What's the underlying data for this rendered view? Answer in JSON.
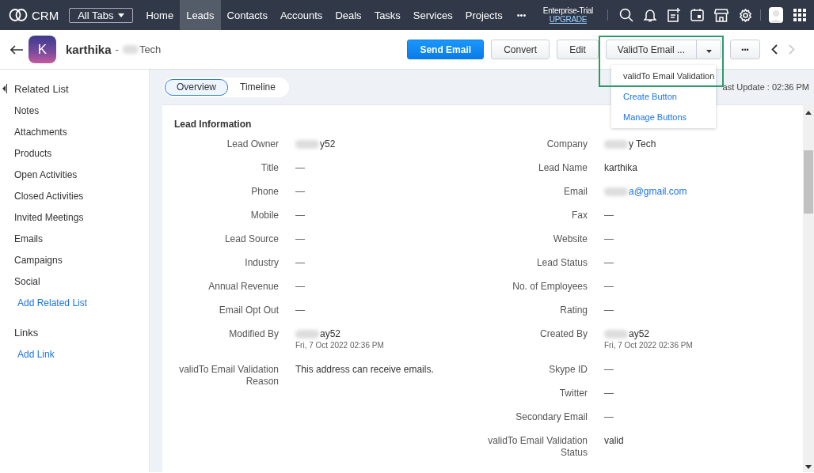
{
  "topbar": {
    "logo_text": "CRM",
    "all_tabs": "All Tabs",
    "nav": [
      {
        "label": "Home",
        "selected": false
      },
      {
        "label": "Leads",
        "selected": true
      },
      {
        "label": "Contacts",
        "selected": false
      },
      {
        "label": "Accounts",
        "selected": false
      },
      {
        "label": "Deals",
        "selected": false
      },
      {
        "label": "Tasks",
        "selected": false
      },
      {
        "label": "Services",
        "selected": false
      },
      {
        "label": "Projects",
        "selected": false
      }
    ],
    "more": "•••",
    "edition": "Enterprise-Trial",
    "upgrade": "UPGRADE"
  },
  "record": {
    "avatar_letter": "K",
    "name": "karthika",
    "separator": "-",
    "company": "Tech",
    "company_blurred": true
  },
  "actions": [
    {
      "label": "Send Email",
      "kind": "primary"
    },
    {
      "label": "Convert",
      "kind": "plain"
    },
    {
      "label": "Edit",
      "kind": "plain"
    },
    {
      "label": "ValidTo Email ...",
      "kind": "split"
    },
    {
      "label": "•••",
      "kind": "more"
    }
  ],
  "nav_arrows": [
    {
      "kind": "prev",
      "disabled": false
    },
    {
      "kind": "next",
      "disabled": true
    }
  ],
  "dropdown": {
    "items": [
      {
        "label": "validTo Email Validation",
        "kind": "action"
      },
      {
        "label": "Create Button",
        "kind": "link"
      },
      {
        "label": "Manage Buttons",
        "kind": "link"
      }
    ]
  },
  "view_tabs": [
    {
      "label": "Overview",
      "selected": true
    },
    {
      "label": "Timeline",
      "selected": false
    }
  ],
  "last_update": "ast Update : 02:36 PM",
  "sidebar": {
    "title": "Related List",
    "items": [
      {
        "label": "Notes",
        "kind": "item"
      },
      {
        "label": "Attachments",
        "kind": "item"
      },
      {
        "label": "Products",
        "kind": "item"
      },
      {
        "label": "Open Activities",
        "kind": "item"
      },
      {
        "label": "Closed Activities",
        "kind": "item"
      },
      {
        "label": "Invited Meetings",
        "kind": "item"
      },
      {
        "label": "Emails",
        "kind": "item"
      },
      {
        "label": "Campaigns",
        "kind": "item"
      },
      {
        "label": "Social",
        "kind": "item"
      },
      {
        "label": "Add Related List",
        "kind": "link"
      }
    ],
    "links_title": "Links",
    "links": [
      {
        "label": "Add Link",
        "kind": "link"
      }
    ]
  },
  "section_title": "Lead Information",
  "columns": [
    [
      {
        "label": "Lead Owner",
        "value": "y52",
        "kind": "text",
        "blurred": true
      },
      {
        "label": "Title",
        "value": "—",
        "kind": "empty"
      },
      {
        "label": "Phone",
        "value": "—",
        "kind": "empty"
      },
      {
        "label": "Mobile",
        "value": "—",
        "kind": "empty"
      },
      {
        "label": "Lead Source",
        "value": "—",
        "kind": "empty"
      },
      {
        "label": "Industry",
        "value": "—",
        "kind": "empty"
      },
      {
        "label": "Annual Revenue",
        "value": "—",
        "kind": "empty"
      },
      {
        "label": "Email Opt Out",
        "value": "—",
        "kind": "empty"
      },
      {
        "label": "Modified By",
        "value": "ay52",
        "kind": "text",
        "blurred": true,
        "sub": "Fri, 7 Oct 2022 02:36 PM"
      },
      {
        "label": "validTo Email Validation Reason",
        "value": "This address can receive emails.",
        "kind": "text"
      }
    ],
    [
      {
        "label": "Company",
        "value": "y Tech",
        "kind": "text",
        "blurred": true
      },
      {
        "label": "Lead Name",
        "value": "karthika",
        "kind": "text"
      },
      {
        "label": "Email",
        "value": "a@gmail.com",
        "kind": "link",
        "blurred": true
      },
      {
        "label": "Fax",
        "value": "—",
        "kind": "empty"
      },
      {
        "label": "Website",
        "value": "—",
        "kind": "empty"
      },
      {
        "label": "Lead Status",
        "value": "—",
        "kind": "empty"
      },
      {
        "label": "No. of Employees",
        "value": "—",
        "kind": "empty"
      },
      {
        "label": "Rating",
        "value": "—",
        "kind": "empty"
      },
      {
        "label": "Created By",
        "value": "ay52",
        "kind": "text",
        "blurred": true,
        "sub": "Fri, 7 Oct 2022 02:36 PM"
      },
      {
        "label": "Skype ID",
        "value": "—",
        "kind": "empty"
      },
      {
        "label": "Twitter",
        "value": "—",
        "kind": "empty"
      },
      {
        "label": "Secondary Email",
        "value": "—",
        "kind": "empty"
      },
      {
        "label": "validTo Email Validation Status",
        "value": "valid",
        "kind": "text"
      }
    ]
  ]
}
